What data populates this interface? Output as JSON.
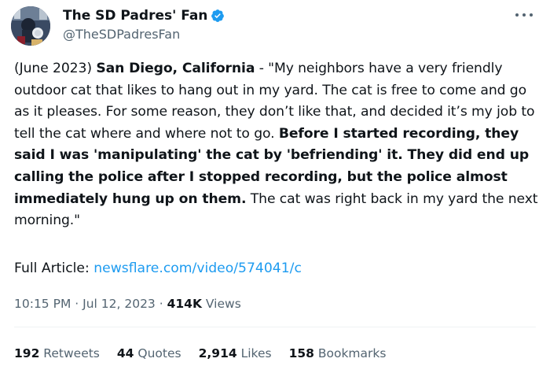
{
  "author": {
    "display_name": "The SD Padres' Fan",
    "handle": "@TheSDPadresFan",
    "verified": true,
    "verified_color": "#1d9bf0"
  },
  "tweet": {
    "segments": [
      {
        "text": "(June 2023) ",
        "bold": false
      },
      {
        "text": "San Diego, California",
        "bold": true
      },
      {
        "text": " - \"My neighbors have a very friendly outdoor cat that likes to hang out in my yard. The cat is free to come and go as it pleases. For some reason, they don’t like that, and decided it’s my job to tell the cat where and where not to go. ",
        "bold": false
      },
      {
        "text": "Before I started recording, they said I was 'manipulating' the cat by 'befriending' it. They did end up calling the police after I stopped recording, but the police almost immediately hung up on them.",
        "bold": true
      },
      {
        "text": " The cat was right back in my yard the next morning.\"",
        "bold": false
      }
    ],
    "full_article_label": "Full Article: ",
    "link_text": "newsflare.com/video/574041/c",
    "time": "10:15 PM",
    "separator": "·",
    "date": "Jul 12, 2023",
    "views_count": "414K",
    "views_label": "Views"
  },
  "stats": {
    "retweets": {
      "count": "192",
      "label": "Retweets"
    },
    "quotes": {
      "count": "44",
      "label": "Quotes"
    },
    "likes": {
      "count": "2,914",
      "label": "Likes"
    },
    "bookmarks": {
      "count": "158",
      "label": "Bookmarks"
    }
  },
  "colors": {
    "text": "#0f1419",
    "secondary": "#536471",
    "link": "#1d9bf0",
    "divider": "#eff3f4"
  },
  "icons": {
    "verified": "verified-badge-icon",
    "more": "more-options-icon"
  }
}
